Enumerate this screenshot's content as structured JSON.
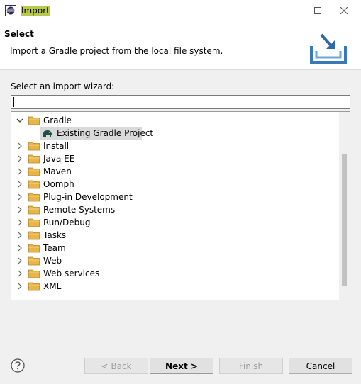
{
  "window": {
    "title": "Import"
  },
  "banner": {
    "title": "Select",
    "description": "Import a Gradle project from the local file system."
  },
  "wizard": {
    "label": "Select an import wizard:",
    "filter_value": "",
    "tree": {
      "gradle": {
        "label": "Gradle",
        "expanded": true,
        "child": {
          "label": "Existing Gradle Project",
          "selected": true
        }
      },
      "install": {
        "label": "Install"
      },
      "java_ee": {
        "label": "Java EE"
      },
      "maven": {
        "label": "Maven"
      },
      "oomph": {
        "label": "Oomph"
      },
      "plugin_dev": {
        "label": "Plug-in Development"
      },
      "remote_systems": {
        "label": "Remote Systems"
      },
      "run_debug": {
        "label": "Run/Debug"
      },
      "tasks": {
        "label": "Tasks"
      },
      "team": {
        "label": "Team"
      },
      "web": {
        "label": "Web"
      },
      "web_services": {
        "label": "Web services"
      },
      "xml": {
        "label": "XML"
      }
    }
  },
  "buttons": {
    "back": "< Back",
    "next": "Next >",
    "finish": "Finish",
    "cancel": "Cancel"
  },
  "icons": {
    "app": "eclipse-icon",
    "folder": "folder-icon",
    "gradle": "gradle-elephant-icon",
    "help": "help-icon",
    "import_banner": "import-tray-icon"
  },
  "colors": {
    "title_highlight": "#b9c74a",
    "selection": "#d9d9d9",
    "folder": "#e8b54a"
  }
}
